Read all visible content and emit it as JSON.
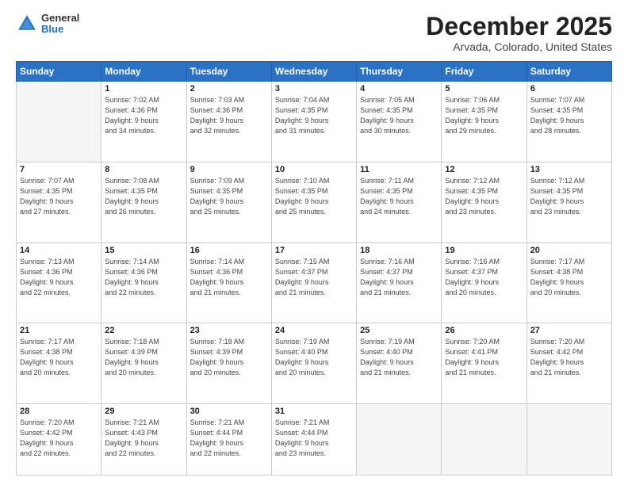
{
  "logo": {
    "general": "General",
    "blue": "Blue"
  },
  "title": "December 2025",
  "subtitle": "Arvada, Colorado, United States",
  "days_of_week": [
    "Sunday",
    "Monday",
    "Tuesday",
    "Wednesday",
    "Thursday",
    "Friday",
    "Saturday"
  ],
  "weeks": [
    [
      {
        "day": "",
        "info": ""
      },
      {
        "day": "1",
        "info": "Sunrise: 7:02 AM\nSunset: 4:36 PM\nDaylight: 9 hours\nand 34 minutes."
      },
      {
        "day": "2",
        "info": "Sunrise: 7:03 AM\nSunset: 4:36 PM\nDaylight: 9 hours\nand 32 minutes."
      },
      {
        "day": "3",
        "info": "Sunrise: 7:04 AM\nSunset: 4:35 PM\nDaylight: 9 hours\nand 31 minutes."
      },
      {
        "day": "4",
        "info": "Sunrise: 7:05 AM\nSunset: 4:35 PM\nDaylight: 9 hours\nand 30 minutes."
      },
      {
        "day": "5",
        "info": "Sunrise: 7:06 AM\nSunset: 4:35 PM\nDaylight: 9 hours\nand 29 minutes."
      },
      {
        "day": "6",
        "info": "Sunrise: 7:07 AM\nSunset: 4:35 PM\nDaylight: 9 hours\nand 28 minutes."
      }
    ],
    [
      {
        "day": "7",
        "info": "Sunrise: 7:07 AM\nSunset: 4:35 PM\nDaylight: 9 hours\nand 27 minutes."
      },
      {
        "day": "8",
        "info": "Sunrise: 7:08 AM\nSunset: 4:35 PM\nDaylight: 9 hours\nand 26 minutes."
      },
      {
        "day": "9",
        "info": "Sunrise: 7:09 AM\nSunset: 4:35 PM\nDaylight: 9 hours\nand 25 minutes."
      },
      {
        "day": "10",
        "info": "Sunrise: 7:10 AM\nSunset: 4:35 PM\nDaylight: 9 hours\nand 25 minutes."
      },
      {
        "day": "11",
        "info": "Sunrise: 7:11 AM\nSunset: 4:35 PM\nDaylight: 9 hours\nand 24 minutes."
      },
      {
        "day": "12",
        "info": "Sunrise: 7:12 AM\nSunset: 4:35 PM\nDaylight: 9 hours\nand 23 minutes."
      },
      {
        "day": "13",
        "info": "Sunrise: 7:12 AM\nSunset: 4:35 PM\nDaylight: 9 hours\nand 23 minutes."
      }
    ],
    [
      {
        "day": "14",
        "info": "Sunrise: 7:13 AM\nSunset: 4:36 PM\nDaylight: 9 hours\nand 22 minutes."
      },
      {
        "day": "15",
        "info": "Sunrise: 7:14 AM\nSunset: 4:36 PM\nDaylight: 9 hours\nand 22 minutes."
      },
      {
        "day": "16",
        "info": "Sunrise: 7:14 AM\nSunset: 4:36 PM\nDaylight: 9 hours\nand 21 minutes."
      },
      {
        "day": "17",
        "info": "Sunrise: 7:15 AM\nSunset: 4:37 PM\nDaylight: 9 hours\nand 21 minutes."
      },
      {
        "day": "18",
        "info": "Sunrise: 7:16 AM\nSunset: 4:37 PM\nDaylight: 9 hours\nand 21 minutes."
      },
      {
        "day": "19",
        "info": "Sunrise: 7:16 AM\nSunset: 4:37 PM\nDaylight: 9 hours\nand 20 minutes."
      },
      {
        "day": "20",
        "info": "Sunrise: 7:17 AM\nSunset: 4:38 PM\nDaylight: 9 hours\nand 20 minutes."
      }
    ],
    [
      {
        "day": "21",
        "info": "Sunrise: 7:17 AM\nSunset: 4:38 PM\nDaylight: 9 hours\nand 20 minutes."
      },
      {
        "day": "22",
        "info": "Sunrise: 7:18 AM\nSunset: 4:39 PM\nDaylight: 9 hours\nand 20 minutes."
      },
      {
        "day": "23",
        "info": "Sunrise: 7:18 AM\nSunset: 4:39 PM\nDaylight: 9 hours\nand 20 minutes."
      },
      {
        "day": "24",
        "info": "Sunrise: 7:19 AM\nSunset: 4:40 PM\nDaylight: 9 hours\nand 20 minutes."
      },
      {
        "day": "25",
        "info": "Sunrise: 7:19 AM\nSunset: 4:40 PM\nDaylight: 9 hours\nand 21 minutes."
      },
      {
        "day": "26",
        "info": "Sunrise: 7:20 AM\nSunset: 4:41 PM\nDaylight: 9 hours\nand 21 minutes."
      },
      {
        "day": "27",
        "info": "Sunrise: 7:20 AM\nSunset: 4:42 PM\nDaylight: 9 hours\nand 21 minutes."
      }
    ],
    [
      {
        "day": "28",
        "info": "Sunrise: 7:20 AM\nSunset: 4:42 PM\nDaylight: 9 hours\nand 22 minutes."
      },
      {
        "day": "29",
        "info": "Sunrise: 7:21 AM\nSunset: 4:43 PM\nDaylight: 9 hours\nand 22 minutes."
      },
      {
        "day": "30",
        "info": "Sunrise: 7:21 AM\nSunset: 4:44 PM\nDaylight: 9 hours\nand 22 minutes."
      },
      {
        "day": "31",
        "info": "Sunrise: 7:21 AM\nSunset: 4:44 PM\nDaylight: 9 hours\nand 23 minutes."
      },
      {
        "day": "",
        "info": ""
      },
      {
        "day": "",
        "info": ""
      },
      {
        "day": "",
        "info": ""
      }
    ]
  ]
}
